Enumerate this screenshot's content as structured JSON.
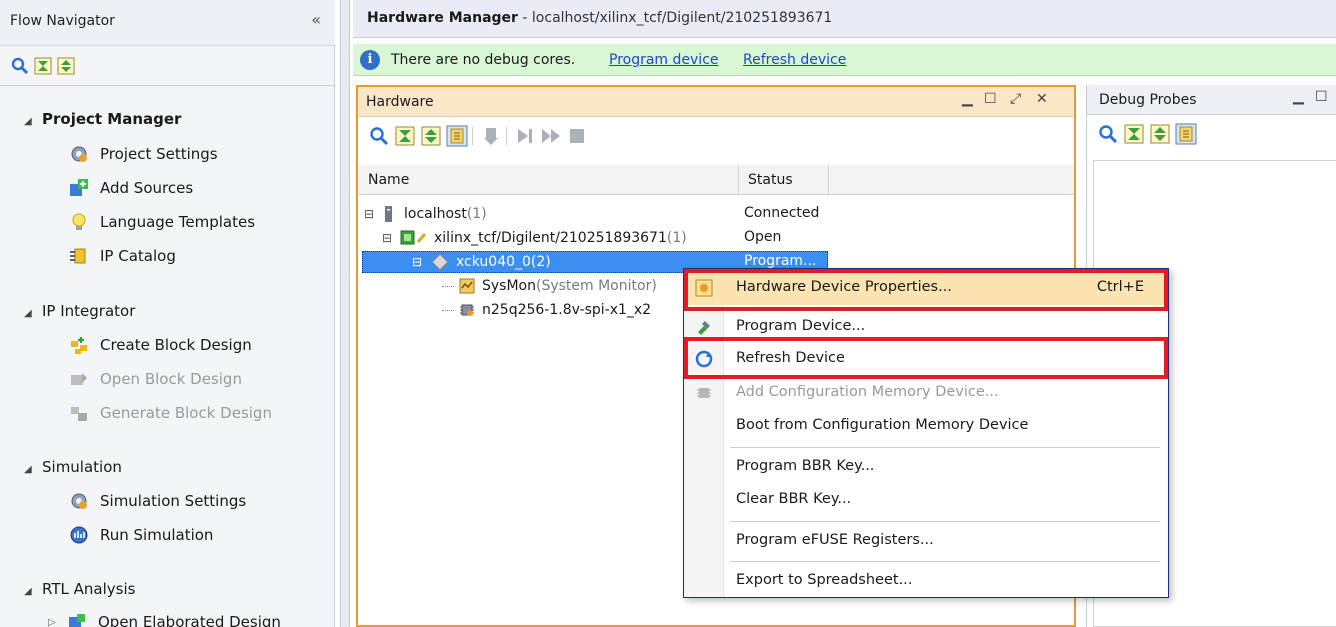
{
  "flow_navigator": {
    "title": "Flow Navigator",
    "collapse_glyph": "«",
    "sections": [
      {
        "title": "Project Manager",
        "items": [
          {
            "label": "Project Settings",
            "icon": "gear-icon"
          },
          {
            "label": "Add Sources",
            "icon": "add-sources-icon"
          },
          {
            "label": "Language Templates",
            "icon": "lightbulb-icon"
          },
          {
            "label": "IP Catalog",
            "icon": "ip-catalog-icon"
          }
        ]
      },
      {
        "title": "IP Integrator",
        "items": [
          {
            "label": "Create Block Design",
            "icon": "create-block-icon"
          },
          {
            "label": "Open Block Design",
            "icon": "open-block-icon"
          },
          {
            "label": "Generate Block Design",
            "icon": "generate-block-icon"
          }
        ]
      },
      {
        "title": "Simulation",
        "items": [
          {
            "label": "Simulation Settings",
            "icon": "gear-icon"
          },
          {
            "label": "Run Simulation",
            "icon": "run-simulation-icon"
          }
        ]
      },
      {
        "title": "RTL Analysis",
        "items": [
          {
            "label": "Open Elaborated Design",
            "icon": "elaborated-design-icon"
          }
        ]
      }
    ]
  },
  "hardware_manager": {
    "title": "Hardware Manager",
    "path": " - localhost/xilinx_tcf/Digilent/210251893671",
    "banner": {
      "message": "There are no debug cores.",
      "link_program": "Program device",
      "link_refresh": "Refresh device"
    }
  },
  "hardware_panel": {
    "title": "Hardware",
    "columns": {
      "name": "Name",
      "status": "Status"
    },
    "rows": [
      {
        "name": "localhost",
        "count": " (1)",
        "status": "Connected"
      },
      {
        "name": "xilinx_tcf/Digilent/210251893671",
        "count": " (1)",
        "status": "Open"
      },
      {
        "name": "xcku040_0",
        "count": " (2)",
        "status": "Program..."
      },
      {
        "name": "SysMon",
        "count": " (System Monitor)",
        "status": ""
      },
      {
        "name": "n25q256-1.8v-spi-x1_x2",
        "count": "",
        "status": ""
      }
    ]
  },
  "debug_panel": {
    "title": "Debug Probes"
  },
  "context_menu": {
    "items": [
      {
        "label": "Hardware Device Properties...",
        "shortcut": "Ctrl+E"
      },
      {
        "label": "Program Device..."
      },
      {
        "label": "Refresh Device"
      },
      {
        "label": "Add Configuration Memory Device..."
      },
      {
        "label": "Boot from Configuration Memory Device"
      },
      {
        "label": "Program BBR Key..."
      },
      {
        "label": "Clear BBR Key..."
      },
      {
        "label": "Program eFUSE Registers..."
      },
      {
        "label": "Export to Spreadsheet..."
      }
    ]
  },
  "colors": {
    "highlight": "#fbe3b2",
    "annotation_red": "#e11c27",
    "panel_active": "#e59a33",
    "banner_bg": "#d8f7d4",
    "link": "#1f46c8"
  }
}
